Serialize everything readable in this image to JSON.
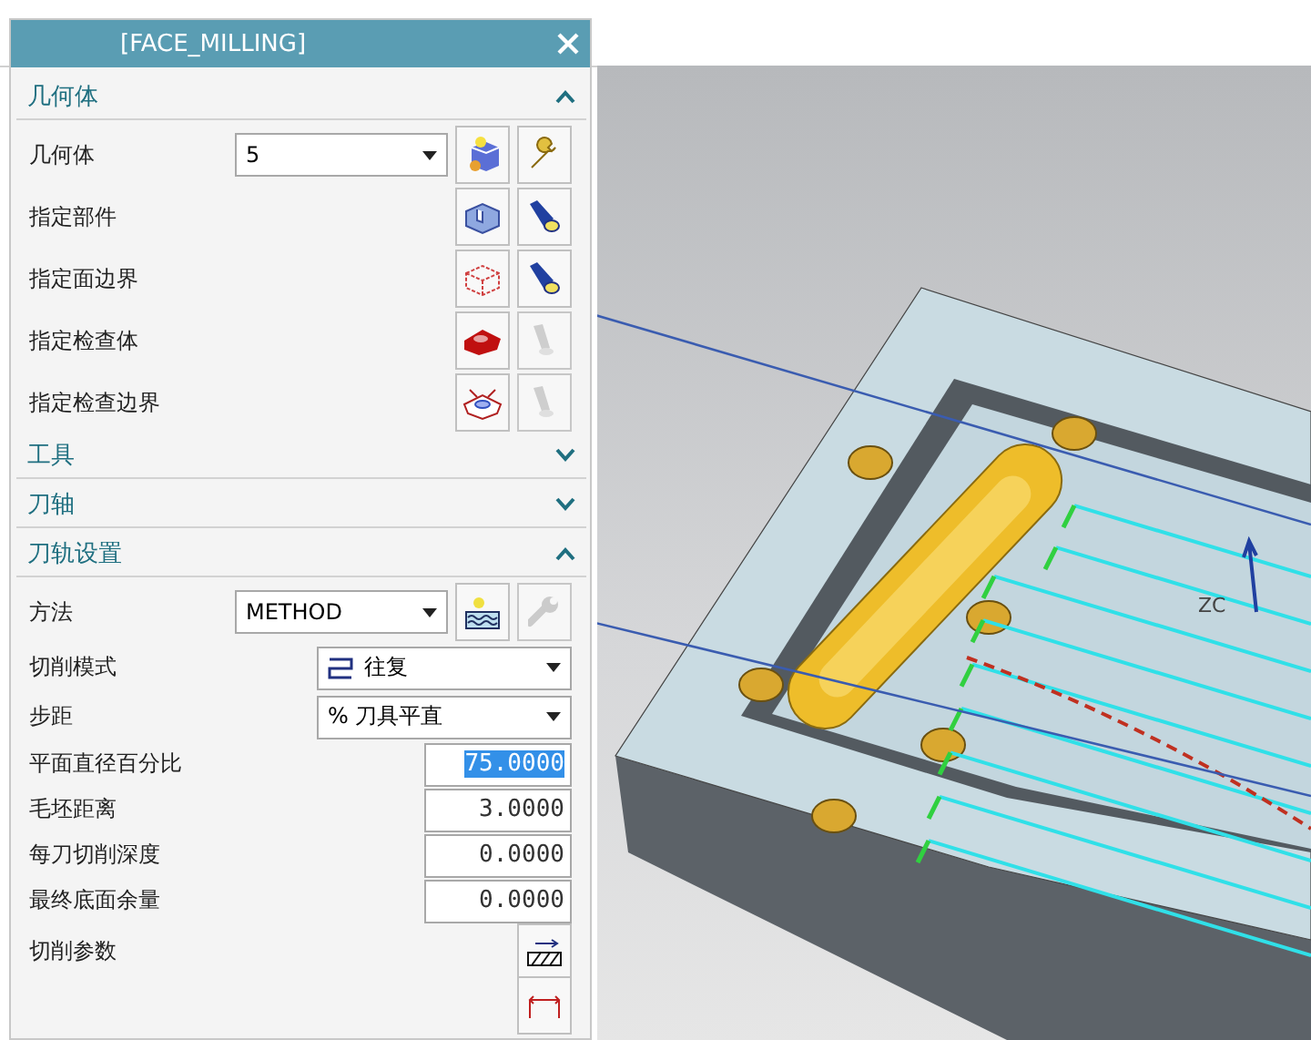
{
  "dialog": {
    "title": "[FACE_MILLING]"
  },
  "sections": [
    {
      "title": "几何体",
      "expanded": true,
      "rows": [
        {
          "kind": "select_buttons",
          "label": "几何体",
          "value": "5",
          "buttons": [
            {
              "disabled": false
            },
            {
              "disabled": false
            }
          ]
        },
        {
          "kind": "buttons",
          "label": "指定部件",
          "buttons": [
            {
              "disabled": false
            },
            {
              "disabled": false
            }
          ]
        },
        {
          "kind": "buttons",
          "label": "指定面边界",
          "buttons": [
            {
              "disabled": false
            },
            {
              "disabled": false
            }
          ]
        },
        {
          "kind": "buttons",
          "label": "指定检查体",
          "buttons": [
            {
              "disabled": false
            },
            {
              "disabled": true
            }
          ]
        },
        {
          "kind": "buttons",
          "label": "指定检查边界",
          "buttons": [
            {
              "disabled": false
            },
            {
              "disabled": true
            }
          ]
        }
      ]
    },
    {
      "title": "工具",
      "expanded": false
    },
    {
      "title": "刀轴",
      "expanded": false
    },
    {
      "title": "刀轨设置",
      "expanded": true,
      "rows": [
        {
          "kind": "select_buttons",
          "label": "方法",
          "value": "METHOD",
          "buttons": [
            {
              "disabled": false
            },
            {
              "disabled": true
            }
          ]
        },
        {
          "kind": "select",
          "label": "切削模式",
          "value": "往复",
          "icon": true
        },
        {
          "kind": "select",
          "label": "步距",
          "value": "% 刀具平直",
          "icon": false
        },
        {
          "kind": "number",
          "label": "平面直径百分比",
          "value": "75.0000",
          "selected": true
        },
        {
          "kind": "number",
          "label": "毛坯距离",
          "value": "3.0000",
          "selected": false
        },
        {
          "kind": "number",
          "label": "每刀切削深度",
          "value": "0.0000",
          "selected": false
        },
        {
          "kind": "number",
          "label": "最终底面余量",
          "value": "0.0000",
          "selected": false
        },
        {
          "kind": "action",
          "label": "切削参数"
        },
        {
          "kind": "action_cut"
        }
      ]
    }
  ],
  "viewport": {
    "axis_label": "ZC"
  }
}
